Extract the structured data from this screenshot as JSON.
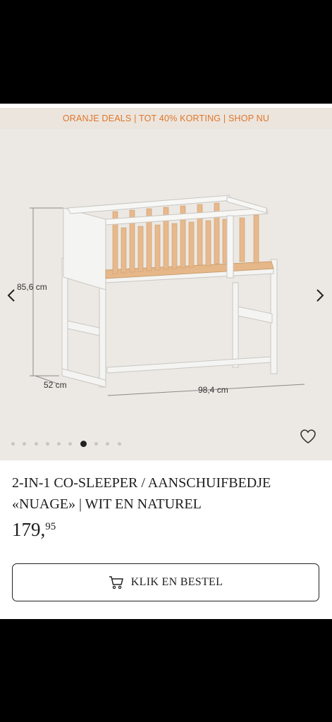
{
  "promo_banner": {
    "text": "ORANJE DEALS | TOT 40% KORTING | SHOP NU",
    "color": "#e0762a",
    "background": "#ece5dd"
  },
  "gallery": {
    "image": "co-sleeper-with-dimensions",
    "dimensions": {
      "height": "85,6 cm",
      "depth": "52 cm",
      "width": "98,4 cm"
    },
    "slide_count": 10,
    "active_slide": 7,
    "prev_icon": "chevron-left-icon",
    "next_icon": "chevron-right-icon",
    "favorite_icon": "heart-icon"
  },
  "product": {
    "title": "2-IN-1 CO-SLEEPER / AANSCHUIFBEDJE «NUAGE» | WIT EN NATUREL",
    "price_main": "179,",
    "price_cents": "95"
  },
  "cta": {
    "label": "KLIK EN BESTEL",
    "icon": "cart-icon"
  }
}
